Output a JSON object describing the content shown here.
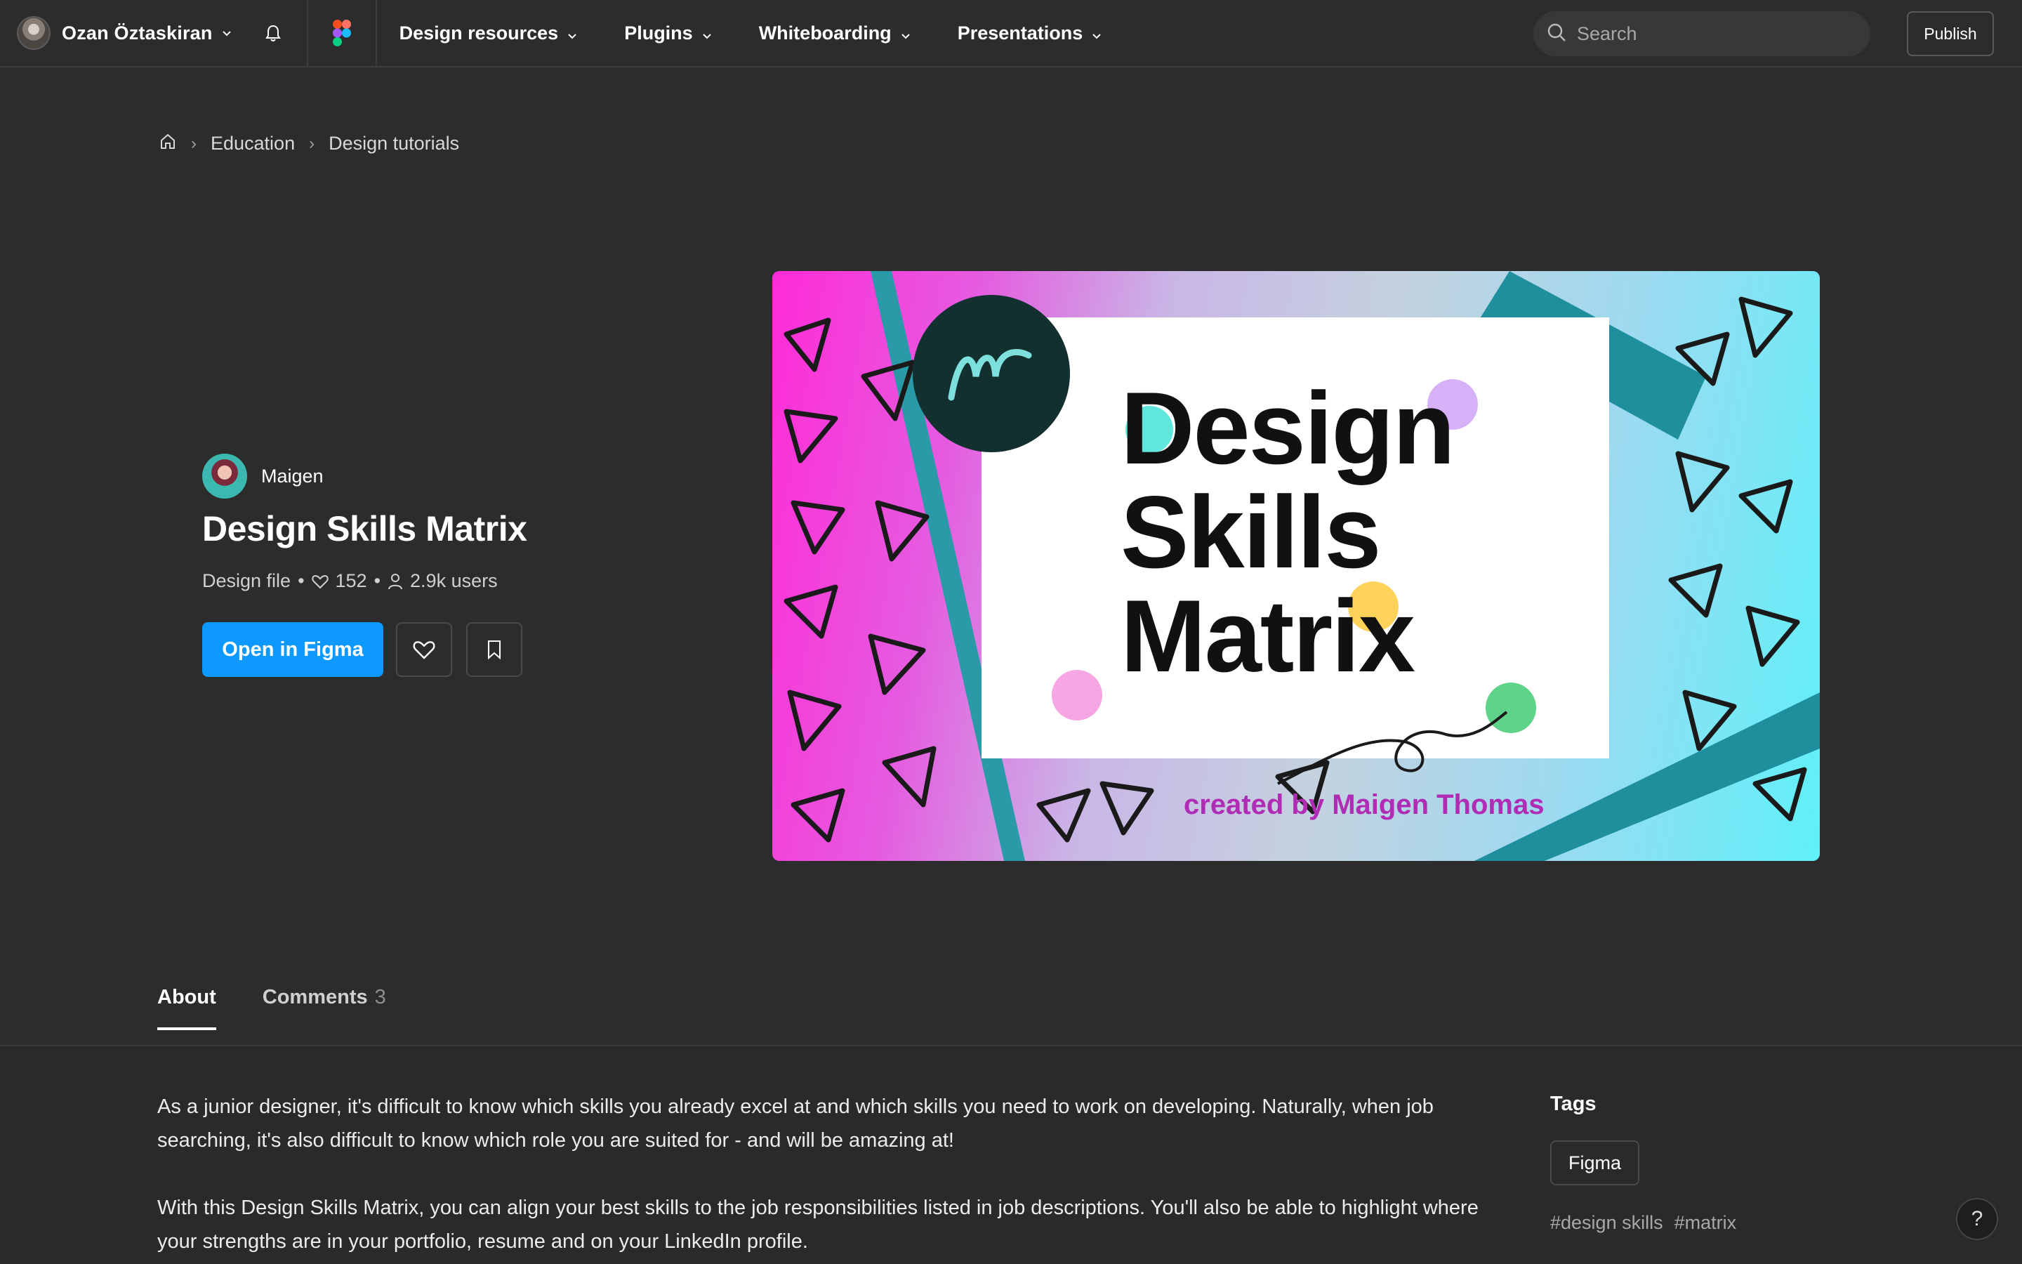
{
  "topbar": {
    "user_name": "Ozan Öztaskiran",
    "nav": [
      {
        "label": "Design resources"
      },
      {
        "label": "Plugins"
      },
      {
        "label": "Whiteboarding"
      },
      {
        "label": "Presentations"
      }
    ],
    "search_placeholder": "Search",
    "publish_label": "Publish"
  },
  "breadcrumb": {
    "items": [
      "Education",
      "Design tutorials"
    ]
  },
  "resource": {
    "author": "Maigen",
    "title": "Design Skills Matrix",
    "type": "Design file",
    "likes": "152",
    "users": "2.9k users",
    "open_label": "Open in Figma"
  },
  "thumbnail": {
    "line1": "Design",
    "line2": "Skills",
    "line3": "Matrix",
    "credit": "created by Maigen Thomas"
  },
  "tabs": [
    {
      "label": "About",
      "count": ""
    },
    {
      "label": "Comments",
      "count": "3"
    }
  ],
  "about": {
    "p1": "As a junior designer, it's difficult to know which skills you already excel at and which skills you need to work on developing. Naturally, when job searching, it's also difficult to know which role you are suited for - and will be amazing at!",
    "p2": "With this Design Skills Matrix, you can align your best skills to the job responsibilities listed in job descriptions. You'll also be able to highlight where your strengths are in your portfolio, resume and on your LinkedIn profile."
  },
  "tags": {
    "heading": "Tags",
    "chip": "Figma",
    "hashtags": [
      "#design skills",
      "#matrix"
    ]
  },
  "help_label": "?",
  "colors": {
    "background": "#2c2c2c",
    "accent": "#0d99ff",
    "credit": "#b02cb5"
  }
}
